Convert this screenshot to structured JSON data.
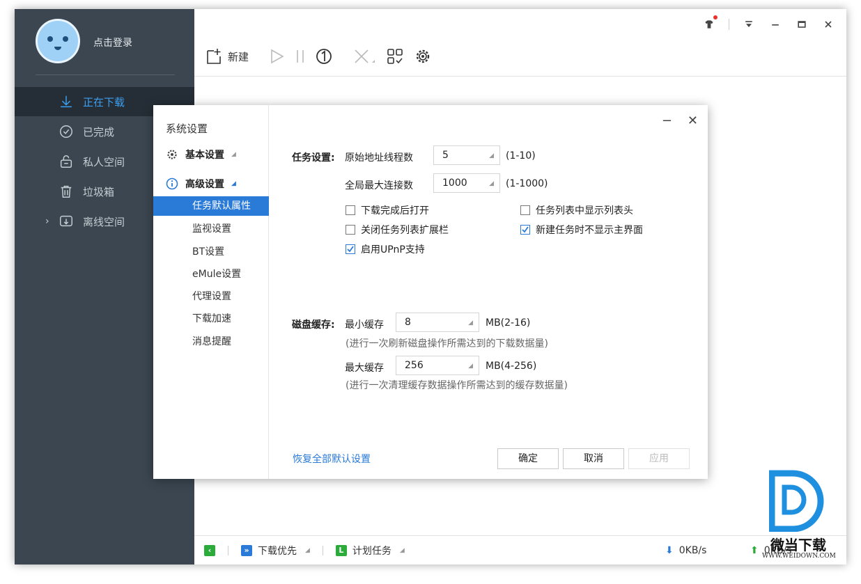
{
  "sidebar": {
    "login": "点击登录",
    "items": [
      {
        "label": "正在下载",
        "icon": "download-arrow-icon"
      },
      {
        "label": "已完成",
        "icon": "check-circle-icon"
      },
      {
        "label": "私人空间",
        "icon": "lock-icon"
      },
      {
        "label": "垃圾箱",
        "icon": "trash-icon"
      },
      {
        "label": "离线空间",
        "icon": "cloud-download-icon"
      }
    ]
  },
  "toolbar": {
    "new_label": "新建"
  },
  "statusbar": {
    "priority": "下载优先",
    "schedule": "计划任务",
    "down_speed": "0KB/s",
    "up_speed": "0KB/s"
  },
  "dialog": {
    "title": "系统设置",
    "groups": [
      {
        "label": "基本设置",
        "icon": "gear-icon"
      },
      {
        "label": "高级设置",
        "icon": "info-icon"
      }
    ],
    "subitems": [
      "任务默认属性",
      "监视设置",
      "BT设置",
      "eMule设置",
      "代理设置",
      "下载加速",
      "消息提醒"
    ],
    "task": {
      "section_label": "任务设置:",
      "threads_label": "原始地址线程数",
      "threads_value": "5",
      "threads_range": "(1-10)",
      "conn_label": "全局最大连接数",
      "conn_value": "1000",
      "conn_range": "(1-1000)",
      "options": [
        {
          "label": "下载完成后打开",
          "checked": false
        },
        {
          "label": "任务列表中显示列表头",
          "checked": false
        },
        {
          "label": "关闭任务列表扩展栏",
          "checked": false
        },
        {
          "label": "新建任务时不显示主界面",
          "checked": true
        },
        {
          "label": "启用UPnP支持",
          "checked": true
        }
      ]
    },
    "cache": {
      "section_label": "磁盘缓存:",
      "min_label": "最小缓存",
      "min_value": "8",
      "min_range": "MB(2-16)",
      "min_hint": "(进行一次刷新磁盘操作所需达到的下载数据量)",
      "max_label": "最大缓存",
      "max_value": "256",
      "max_range": "MB(4-256)",
      "max_hint": "(进行一次清理缓存数据操作所需达到的缓存数据量)"
    },
    "restore_label": "恢复全部默认设置",
    "ok_label": "确定",
    "cancel_label": "取消",
    "apply_label": "应用"
  },
  "watermark": {
    "text": "微当下载",
    "url": "WWW.WEIDOWN.COM"
  },
  "colors": {
    "accent": "#2a7ad8",
    "sidebar_bg": "#3b4650",
    "sidebar_active": "#252e36",
    "green": "#2bab39"
  }
}
